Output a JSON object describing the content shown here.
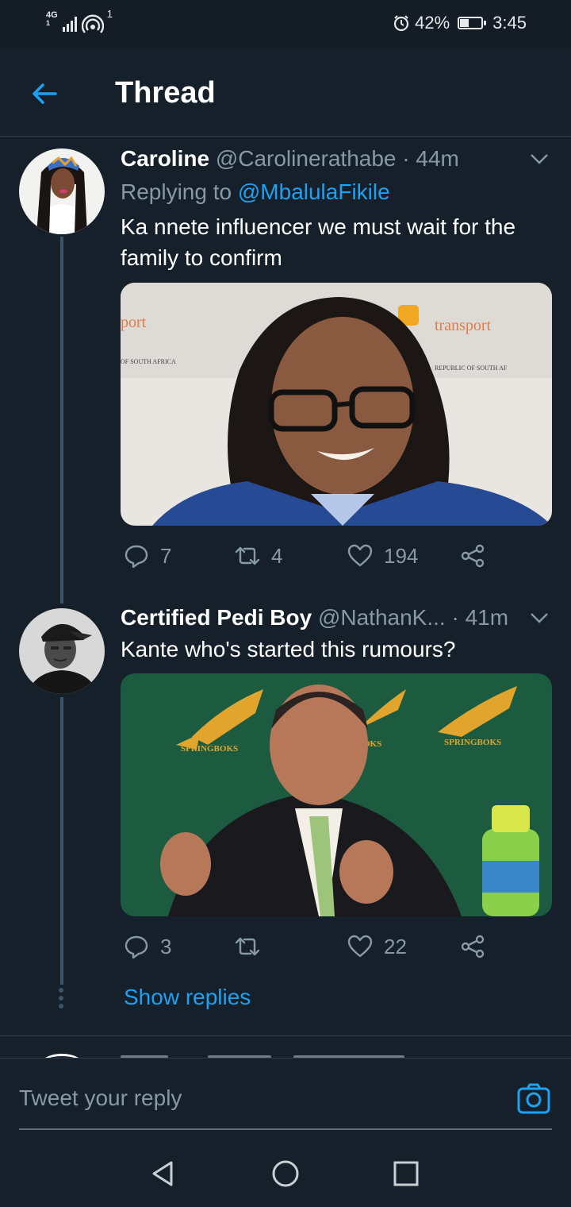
{
  "status_bar": {
    "network": "4G",
    "network_sub": "1",
    "notification_count": "1",
    "battery_percent": "42%",
    "battery_level": 0.42,
    "time": "3:45",
    "icons": [
      "signal-icon",
      "wifi-hotspot-icon",
      "alarm-icon",
      "battery-icon"
    ]
  },
  "header": {
    "back_icon": "back-arrow-icon",
    "title": "Thread"
  },
  "tweets": [
    {
      "name": "Caroline",
      "handle": "@Carolinerathabe",
      "time": "· 44m",
      "replying_prefix": "Replying to",
      "replying_to": "@MbalulaFikile",
      "text": "Ka nnete influencer we must wait for the family to confirm",
      "media_alt": "photo-woman-glasses",
      "media_text": {
        "sign_left": "port",
        "sign_left_small": "OF SOUTH AFRICA",
        "sign_right": "transport",
        "sign_right_small": "REPUBLIC OF SOUTH AF"
      },
      "replies": "7",
      "retweets": "4",
      "likes": "194"
    },
    {
      "name": "Certified Pedi Boy",
      "handle": "@NathanK...",
      "time": "· 41m",
      "text": "Kante who's started this rumours?",
      "media_alt": "photo-man-springboks",
      "media_text": {
        "brand": "SPRINGBOKS",
        "brand_partial": "OKS"
      },
      "replies": "3",
      "retweets": "",
      "likes": "22"
    }
  ],
  "show_replies": "Show replies",
  "reply_bar": {
    "placeholder": "Tweet your reply",
    "camera_icon": "camera-icon"
  },
  "nav": {
    "back": "nav-back-icon",
    "home": "nav-home-icon",
    "recents": "nav-recents-icon"
  },
  "colors": {
    "background": "#15202b",
    "accent": "#1da1f2",
    "muted": "#8899a6",
    "divider": "#2f3d4b"
  }
}
